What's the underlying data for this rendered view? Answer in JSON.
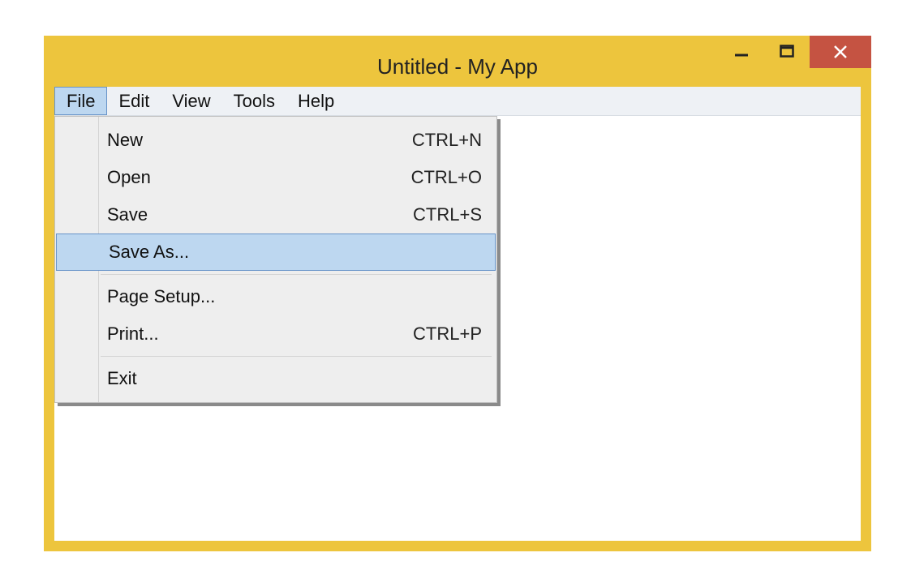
{
  "window": {
    "title": "Untitled - My App"
  },
  "menubar": {
    "items": [
      {
        "label": "File",
        "active": true
      },
      {
        "label": "Edit",
        "active": false
      },
      {
        "label": "View",
        "active": false
      },
      {
        "label": "Tools",
        "active": false
      },
      {
        "label": "Help",
        "active": false
      }
    ]
  },
  "file_menu": {
    "groups": [
      [
        {
          "label": "New",
          "shortcut": "CTRL+N",
          "highlight": false
        },
        {
          "label": "Open",
          "shortcut": "CTRL+O",
          "highlight": false
        },
        {
          "label": "Save",
          "shortcut": "CTRL+S",
          "highlight": false
        },
        {
          "label": "Save As...",
          "shortcut": "",
          "highlight": true
        }
      ],
      [
        {
          "label": "Page Setup...",
          "shortcut": "",
          "highlight": false
        },
        {
          "label": "Print...",
          "shortcut": "CTRL+P",
          "highlight": false
        }
      ],
      [
        {
          "label": "Exit",
          "shortcut": "",
          "highlight": false
        }
      ]
    ]
  },
  "colors": {
    "chrome": "#edc53d",
    "close": "#c55342",
    "highlight_bg": "#bdd7f0",
    "highlight_border": "#6894c9"
  }
}
